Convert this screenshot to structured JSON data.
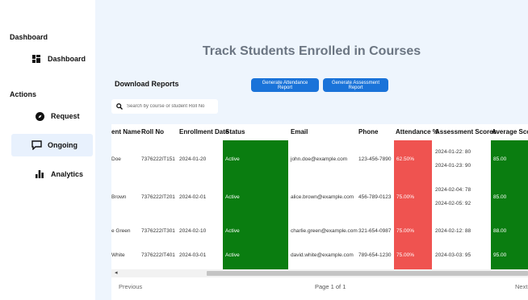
{
  "sidebar": {
    "section_dashboard": "Dashboard",
    "section_actions": "Actions",
    "items": [
      {
        "label": "Dashboard",
        "icon": "dashboard-grid-icon"
      },
      {
        "label": "Request",
        "icon": "compass-icon"
      },
      {
        "label": "Ongoing",
        "icon": "message-square-icon",
        "active": true
      },
      {
        "label": "Analytics",
        "icon": "bar-chart-icon"
      }
    ]
  },
  "main": {
    "title": "Track Students Enrolled in Courses",
    "download_label": "Download Reports",
    "btn_attendance": "Generate Attendance Report",
    "btn_assessment": "Generate Assessment Report",
    "search_placeholder": "Search by course or student Roll No"
  },
  "table": {
    "headers": [
      "ent Name",
      "Roll No",
      "Enrollment Date",
      "Status",
      "Email",
      "Phone",
      "Attendance %",
      "Assessment Scores",
      "Average Score"
    ],
    "rows": [
      {
        "name": "Doe",
        "roll": "7376222IT151",
        "date": "2024-01-20",
        "status": "Active",
        "email": "john.doe@example.com",
        "phone": "123-456-7890",
        "attendance": "62.50%",
        "scores": [
          "2024-01-22: 80",
          "2024-01-23: 90"
        ],
        "avg": "85.00"
      },
      {
        "name": "Brown",
        "roll": "7376222IT201",
        "date": "2024-02-01",
        "status": "Active",
        "email": "alice.brown@example.com",
        "phone": "456-789-0123",
        "attendance": "75.00%",
        "scores": [
          "2024-02-04: 78",
          "2024-02-05: 92"
        ],
        "avg": "85.00"
      },
      {
        "name": "e Green",
        "roll": "7376222IT301",
        "date": "2024-02-10",
        "status": "Active",
        "email": "charlie.green@example.com",
        "phone": "321-654-0987",
        "attendance": "75.00%",
        "scores": [
          "2024-02-12: 88"
        ],
        "avg": "88.00"
      },
      {
        "name": "White",
        "roll": "7376222IT401",
        "date": "2024-03-01",
        "status": "Active",
        "email": "david.white@example.com",
        "phone": "789-654-1230",
        "attendance": "75.00%",
        "scores": [
          "2024-03-03: 95"
        ],
        "avg": "95.00"
      }
    ]
  },
  "pagination": {
    "prev": "Previous",
    "info": "Page 1 of 1",
    "next": "Next",
    "scroll_left_arrow": "◂"
  },
  "colors": {
    "accent": "#1a73d9",
    "status_active": "#0a7d10",
    "attendance_low": "#ef5350",
    "main_bg": "#eef5fd"
  }
}
